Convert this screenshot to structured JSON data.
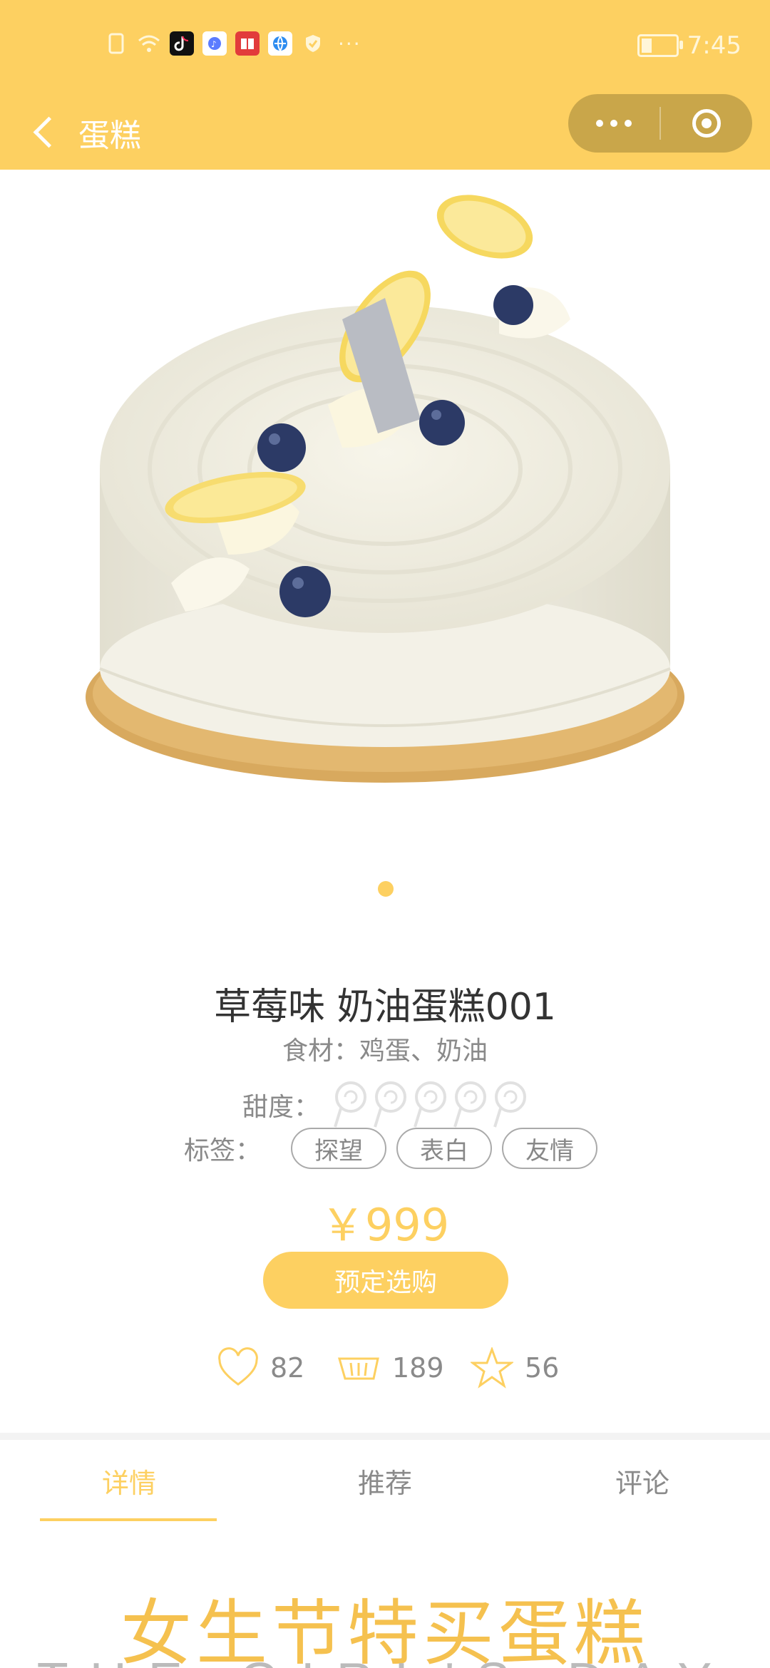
{
  "status_bar": {
    "time": "7:45",
    "more_glyph": "···"
  },
  "nav": {
    "title": "蛋糕"
  },
  "product": {
    "name": "草莓味 奶油蛋糕001",
    "ingredients": "食材：鸡蛋、奶油",
    "sweetness_label": "甜度：",
    "sweetness_level": 0,
    "sweetness_max": 5,
    "tags_label": "标签：",
    "tags": [
      "探望",
      "表白",
      "友情"
    ],
    "price": "￥999",
    "buy_label": "预定选购"
  },
  "stats": {
    "likes": "82",
    "cart": "189",
    "favorites": "56"
  },
  "tabs": [
    "详情",
    "推荐",
    "评论"
  ],
  "banner": {
    "title_cn": "女生节特买蛋糕",
    "title_en": "THE GIRL'S DAY"
  },
  "colors": {
    "accent": "#fdd061",
    "nav_capsule": "#c9a64a",
    "text_muted": "#8a8a8a"
  }
}
